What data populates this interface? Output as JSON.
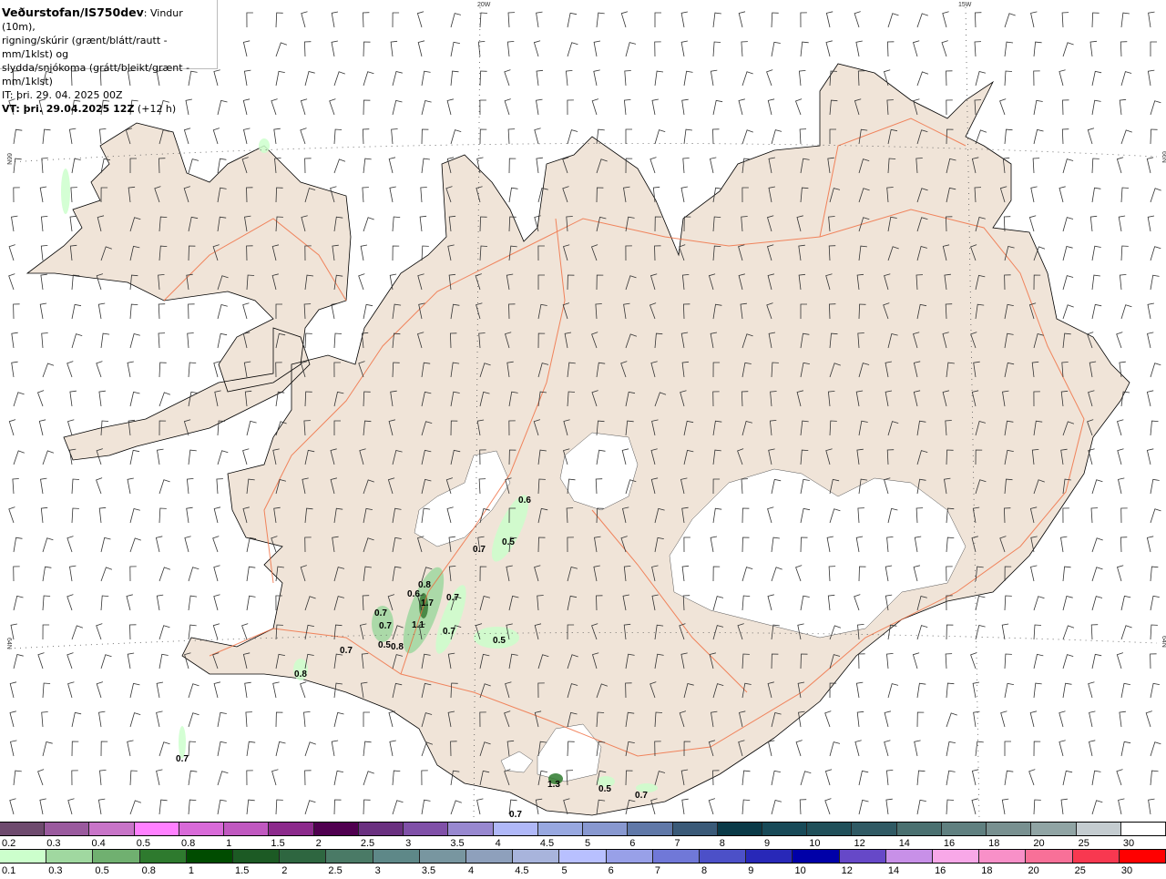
{
  "header": {
    "source": "Veðurstofan/IS750dev",
    "line1_rest": ": Vindur (10m),",
    "line2": "rigning/skúrir (grænt/blátt/rautt - mm/1klst) og",
    "line3": "slydda/snjókoma (grátt/bleikt/grænt - mm/1klst)",
    "it_label": "IT: þri. 29. 04. 2025 00Z",
    "vt_bold": "VT: þri. 29.04.2025 12Z",
    "vt_offset": " (+12 h)"
  },
  "grid_labels": {
    "lon1": "20W",
    "lon2": "15W",
    "lat1": "66N",
    "lat2": "64N"
  },
  "colors": {
    "land": "#f0e4d8",
    "roads": "#f06a3c",
    "glacier": "#ffffff",
    "precip_light": "#ccffcc",
    "precip_mid": "#a0d8a0"
  },
  "precip_values": [
    {
      "text": "0.6"
    },
    {
      "text": "0.7"
    },
    {
      "text": "0.5"
    },
    {
      "text": "0.8"
    },
    {
      "text": "0.6"
    },
    {
      "text": "1.7"
    },
    {
      "text": "0.7"
    },
    {
      "text": "0.7"
    },
    {
      "text": "0.7"
    },
    {
      "text": "1.1"
    },
    {
      "text": "0.7"
    },
    {
      "text": "0.5"
    },
    {
      "text": "0.5"
    },
    {
      "text": "0.8"
    },
    {
      "text": "0.7"
    },
    {
      "text": "0.8"
    },
    {
      "text": "0.7"
    },
    {
      "text": "1.3"
    },
    {
      "text": "0.5"
    },
    {
      "text": "0.7"
    },
    {
      "text": "0.7"
    }
  ],
  "legend_snow": {
    "labels": [
      "0.2",
      "0.3",
      "0.4",
      "0.5",
      "0.8",
      "1",
      "1.5",
      "2",
      "2.5",
      "3",
      "3.5",
      "4",
      "4.5",
      "5",
      "6",
      "7",
      "8",
      "9",
      "10",
      "12",
      "14",
      "16",
      "18",
      "20",
      "25",
      "30"
    ],
    "colors": [
      "#6e4a6e",
      "#9a5a9e",
      "#c874c8",
      "#ff80ff",
      "#d86ad8",
      "#c058c0",
      "#8c2a8c",
      "#500050",
      "#6a3080",
      "#8050a8",
      "#9888d0",
      "#b0b8f8",
      "#98a8e0",
      "#8898d0",
      "#6078a8",
      "#3a5a78",
      "#0a3a48",
      "#184a58",
      "#20505a",
      "#305a64",
      "#4a7070",
      "#608080",
      "#789090",
      "#90a4a4",
      "#c4ccd0",
      "#ffffff"
    ]
  },
  "legend_rain": {
    "labels": [
      "0.1",
      "0.3",
      "0.5",
      "0.8",
      "1",
      "1.5",
      "2",
      "2.5",
      "3",
      "3.5",
      "4",
      "4.5",
      "5",
      "6",
      "7",
      "8",
      "9",
      "10",
      "12",
      "14",
      "16",
      "18",
      "20",
      "25",
      "30"
    ],
    "colors": [
      "#ccffcc",
      "#a0d8a0",
      "#70b070",
      "#2e7a2e",
      "#004c00",
      "#1c5a24",
      "#2e6640",
      "#4a7a66",
      "#5e8888",
      "#7896a0",
      "#8ea0bc",
      "#a8b4dc",
      "#b8c0ff",
      "#98a0e8",
      "#7078d8",
      "#4c50c8",
      "#2828b8",
      "#0000a8",
      "#6648c8",
      "#c890e8",
      "#f8a8e8",
      "#f890c8",
      "#f87098",
      "#f83850",
      "#ff0000"
    ]
  }
}
